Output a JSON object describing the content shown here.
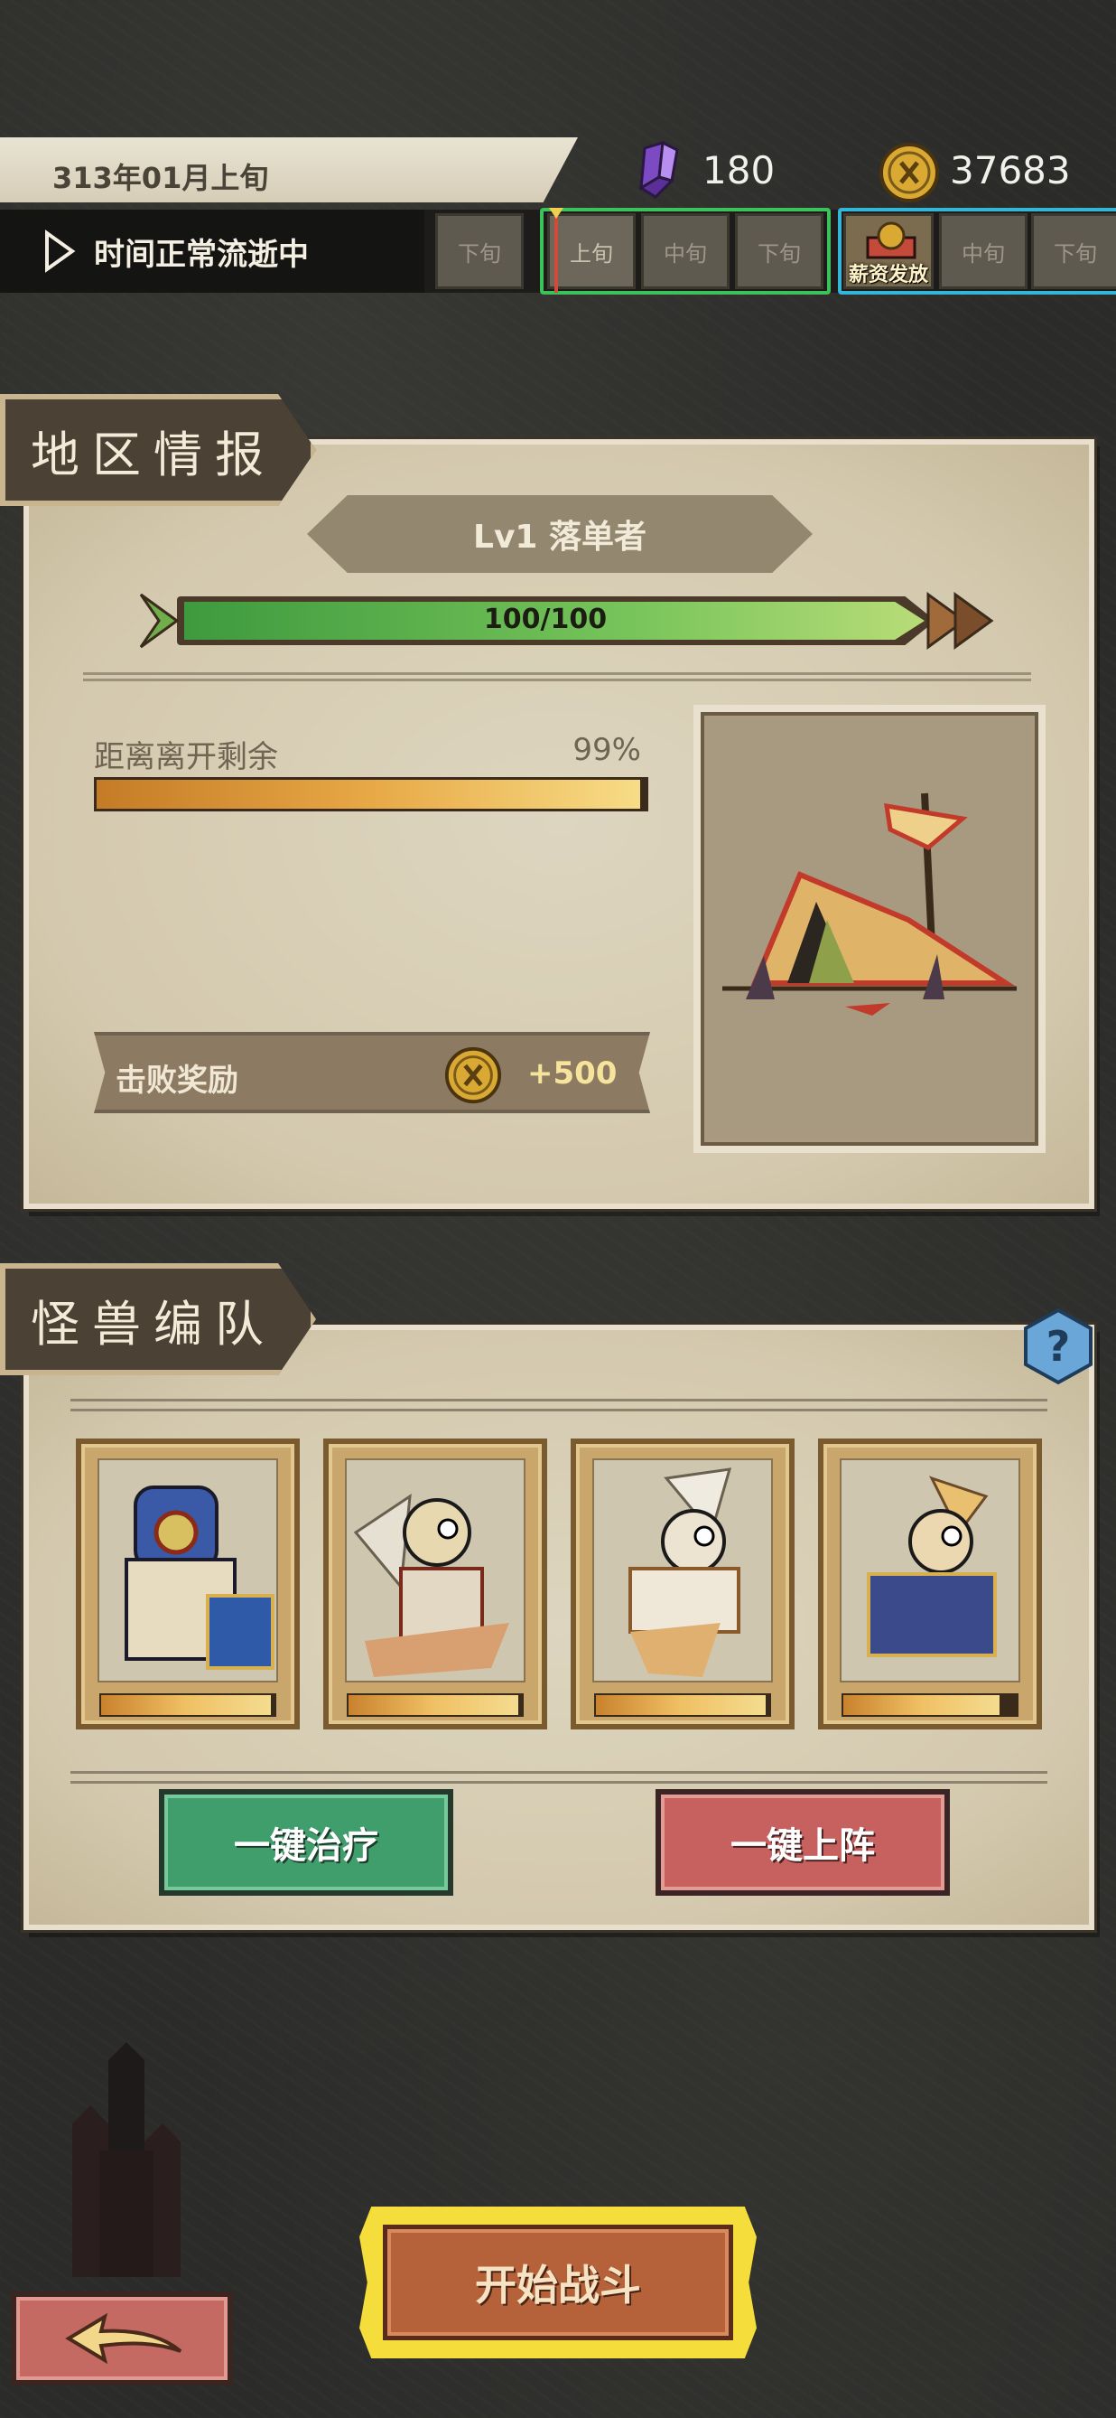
{
  "topbar": {
    "date": "313年01月上旬",
    "crystals": "180",
    "gold": "37683",
    "time_status": "时间正常流逝中",
    "slots": [
      "下旬",
      "上旬",
      "中旬",
      "下旬",
      "中旬",
      "下旬"
    ],
    "payday_label": "薪资发放"
  },
  "region": {
    "header": "地区情报",
    "title": "Lv1 落单者",
    "hp_text": "100/100",
    "hp_fraction": 1.0,
    "leave_label": "距离离开剩余",
    "leave_pct": "99%",
    "leave_fraction": 0.99,
    "reward_label": "击败奖励",
    "reward_value": "+500"
  },
  "team": {
    "header": "怪兽编队",
    "members": [
      {
        "icon": "monster-portrait-blue-knight",
        "hp_fraction": 0.98
      },
      {
        "icon": "monster-portrait-winged-skull",
        "hp_fraction": 0.98
      },
      {
        "icon": "monster-portrait-white-armored",
        "hp_fraction": 0.98
      },
      {
        "icon": "monster-portrait-golden-knight",
        "hp_fraction": 0.9
      }
    ],
    "heal_label": "一键治疗",
    "deploy_label": "一键上阵"
  },
  "actions": {
    "start_label": "开始战斗"
  },
  "colors": {
    "hp_green": "#77c45a",
    "heal_green": "#3f9e6c",
    "deploy_red": "#c6615f",
    "start_yellow": "#f5dd3c",
    "month_frame_green": "#3cc15b",
    "month_frame_blue": "#34b6d8"
  }
}
